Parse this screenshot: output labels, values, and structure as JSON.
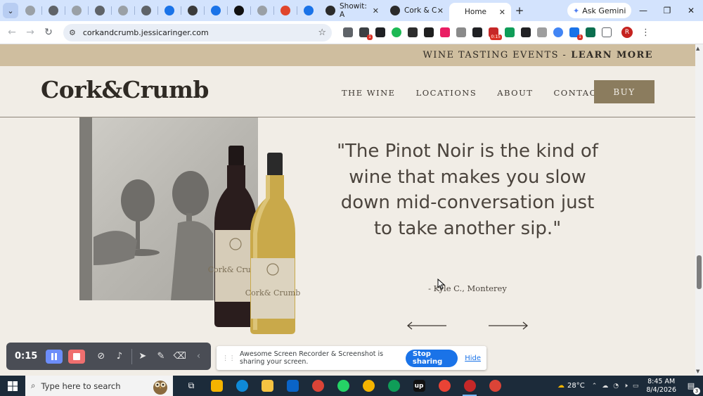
{
  "browser": {
    "tabs": [
      {
        "title": "Showit: A",
        "icon": "showit-icon"
      },
      {
        "title": "Cork & C",
        "icon": "showit-icon"
      },
      {
        "title": "Home",
        "icon": "",
        "active": true
      }
    ],
    "mini_tab_count": 13,
    "gemini_label": "Ask Gemini",
    "url": "corkandcrumb.jessicaringer.com",
    "profile_initial": "R",
    "ext_badge_time": "0:15"
  },
  "site": {
    "promo_text": "WINE TASTING EVENTS -",
    "promo_link": "LEARN MORE",
    "logo": "Cork&Crumb",
    "nav": [
      "THE WINE",
      "LOCATIONS",
      "ABOUT",
      "CONTACT"
    ],
    "buy_label": "BUY",
    "quote": "\"The Pinot Noir is the kind of wine that makes you slow down mid-conversation just to take another sip.\"",
    "attribution": "- Kyle C., Monterey",
    "label_text": "Cork& Crumb"
  },
  "recorder": {
    "time": "0:15"
  },
  "share": {
    "message": "Awesome Screen Recorder & Screenshot is sharing your screen.",
    "stop_label": "Stop sharing",
    "hide_label": "Hide"
  },
  "taskbar": {
    "search_placeholder": "Type here to search",
    "temperature": "28°C",
    "time": "8:45 AM",
    "date": "8/4/2026",
    "notification_count": "3"
  },
  "colors": {
    "background": "#f1ede6",
    "promo_band": "#cfbe9f",
    "buy_button": "#8b7c5e",
    "text": "#2f2a24"
  }
}
